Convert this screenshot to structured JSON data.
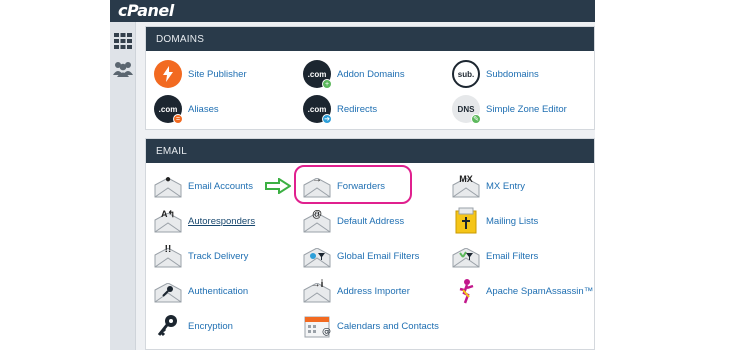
{
  "brand": "cPanel",
  "sections": {
    "domains": {
      "title": "DOMAINS",
      "items": [
        {
          "label": "Site Publisher",
          "icon": "lightning-icon"
        },
        {
          "label": "Addon Domains",
          "icon": "dotcom-add-icon"
        },
        {
          "label": "Subdomains",
          "icon": "sub-icon"
        },
        {
          "label": "Aliases",
          "icon": "dotcom-alias-icon"
        },
        {
          "label": "Redirects",
          "icon": "dotcom-redirect-icon"
        },
        {
          "label": "Simple Zone Editor",
          "icon": "dns-icon"
        }
      ]
    },
    "email": {
      "title": "EMAIL",
      "items": [
        {
          "label": "Email Accounts",
          "icon": "email-accounts-icon"
        },
        {
          "label": "Forwarders",
          "icon": "forwarders-icon"
        },
        {
          "label": "MX Entry",
          "icon": "mx-entry-icon"
        },
        {
          "label": "Autoresponders",
          "icon": "autoresponders-icon"
        },
        {
          "label": "Default Address",
          "icon": "default-address-icon"
        },
        {
          "label": "Mailing Lists",
          "icon": "mailing-lists-icon"
        },
        {
          "label": "Track Delivery",
          "icon": "track-delivery-icon"
        },
        {
          "label": "Global Email Filters",
          "icon": "global-filters-icon"
        },
        {
          "label": "Email Filters",
          "icon": "email-filters-icon"
        },
        {
          "label": "Authentication",
          "icon": "authentication-icon"
        },
        {
          "label": "Address Importer",
          "icon": "address-importer-icon"
        },
        {
          "label": "Apache SpamAssassin™",
          "icon": "spamassassin-icon"
        },
        {
          "label": "Encryption",
          "icon": "key-icon"
        },
        {
          "label": "Calendars and Contacts",
          "icon": "calendar-icon"
        }
      ]
    }
  },
  "colors": {
    "header_bg": "#293a4a",
    "link": "#1f6fb2",
    "highlight": "#e0208e",
    "arrow": "#3cb043"
  }
}
